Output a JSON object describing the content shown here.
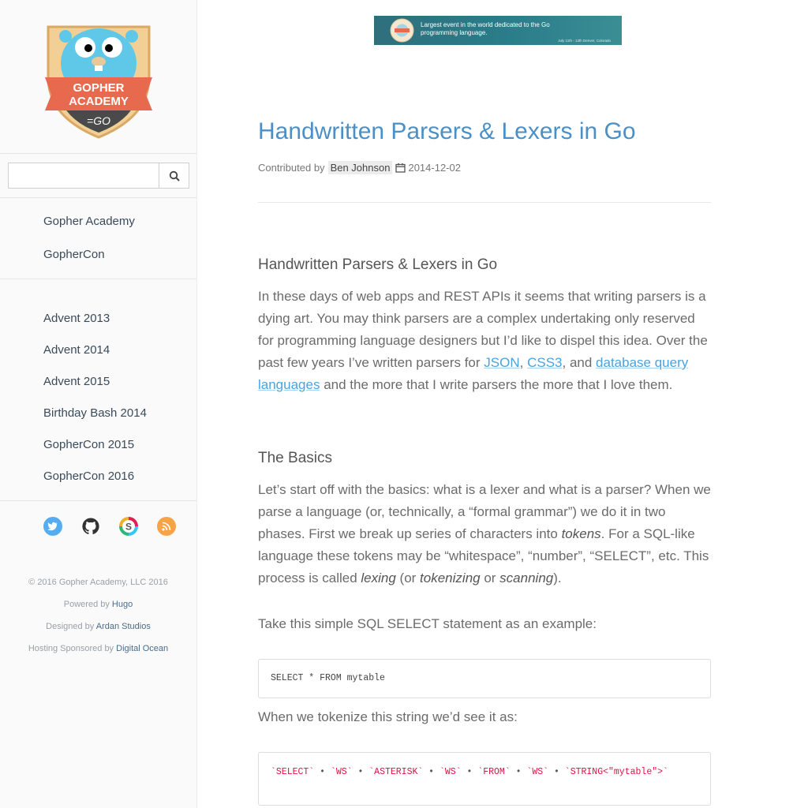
{
  "sidebar": {
    "logo": {
      "title": "GOPHER ACADEMY",
      "line1": "GOPHER",
      "line2": "ACADEMY",
      "mark": "=GO"
    },
    "search": {
      "value": "",
      "placeholder": ""
    },
    "nav_primary": [
      "Gopher Academy",
      "GopherCon"
    ],
    "nav_secondary": [
      "Advent 2013",
      "Advent 2014",
      "Advent 2015",
      "Birthday Bash 2014",
      "GopherCon 2015",
      "GopherCon 2016"
    ],
    "social_icons": [
      "twitter-icon",
      "github-icon",
      "slack-icon",
      "rss-icon"
    ],
    "colors": {
      "twitter": "#55acee",
      "github": "#333333",
      "slack": "#e9a820",
      "rss": "#f7a347"
    },
    "footer": {
      "copyright": "© 2016 Gopher Academy, LLC 2016",
      "powered_prefix": "Powered by",
      "powered_link": "Hugo",
      "designed_prefix": "Designed by",
      "designed_link": "Ardan Studios",
      "hosting_prefix": "Hosting Sponsored by",
      "hosting_link": "Digital Ocean"
    }
  },
  "banner": {
    "text": "Largest event in the world dedicated to the Go programming language.",
    "subtext": "July 11th - 13th Denver, Colorado"
  },
  "article": {
    "title": "Handwritten Parsers & Lexers in Go",
    "contributed_by": "Contributed by",
    "author": "Ben Johnson",
    "date": "2014-12-02",
    "heading1": "Handwritten Parsers & Lexers in Go",
    "para1": {
      "text1": "In these days of web apps and REST APIs it seems that writing parsers is a dying art. You may think parsers are a complex undertaking only reserved for programming language designers but I’d like to dispel this idea. Over the past few years I’ve written parsers for ",
      "link_json": "JSON",
      "sep1": ", ",
      "link_css3": "CSS3",
      "text2": ", and ",
      "link_db": "database query languages",
      "text3": " and the more that I write parsers the more that I love them."
    },
    "heading2": "The Basics",
    "para2": {
      "text1": "Let’s start off with the basics: what is a lexer and what is a parser? When we parse a language (or, technically, a “formal grammar”) we do it in two phases. First we break up series of characters into ",
      "em_tokens": "tokens",
      "text2": ". For a SQL-like language these tokens may be “whitespace”, “number”, “SELECT”, etc. This process is called ",
      "em_lexing": "lexing",
      "text3": " (or ",
      "em_tokenizing": "tokenizing",
      "text4": " or ",
      "em_scanning": "scanning",
      "text5": ")."
    },
    "para3": "Take this simple SQL SELECT statement as an example:",
    "code1": "SELECT * FROM mytable",
    "para4": "When we tokenize this string we’d see it as:",
    "tokens": [
      "`SELECT`",
      "`WS`",
      "`ASTERISK`",
      "`WS`",
      "`FROM`",
      "`WS`",
      "`STRING<\"mytable\">`"
    ]
  }
}
